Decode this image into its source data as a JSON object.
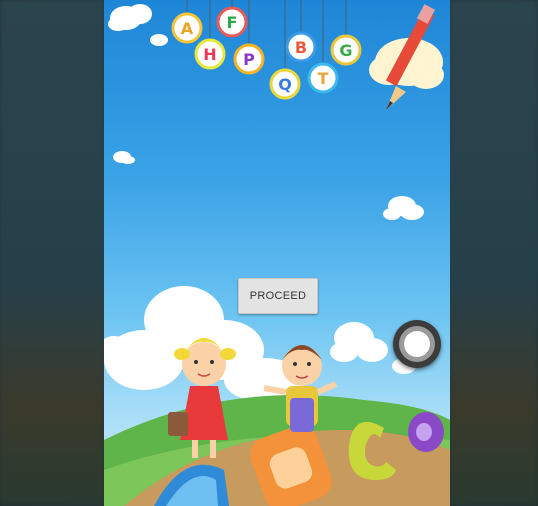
{
  "screen": {
    "background_colors": {
      "sky_top": "#1e86d6",
      "sky_bottom": "#c9ebfb",
      "letterbox": "#2a3f48"
    }
  },
  "hanging_letters": [
    {
      "letter": "A",
      "color": "#e8a422",
      "ring": "#f7c43a"
    },
    {
      "letter": "F",
      "color": "#2ca84a",
      "ring": "#e85a5a"
    },
    {
      "letter": "H",
      "color": "#e83a5a",
      "ring": "#e8e83a"
    },
    {
      "letter": "P",
      "color": "#8a3ac8",
      "ring": "#f5b323"
    },
    {
      "letter": "B",
      "color": "#e85a3a",
      "ring": "#3a9ae8"
    },
    {
      "letter": "G",
      "color": "#3aa84a",
      "ring": "#e8c83a"
    },
    {
      "letter": "Q",
      "color": "#3a7ae8",
      "ring": "#e8d83a"
    },
    {
      "letter": "T",
      "color": "#e8a43a",
      "ring": "#3ab8e8"
    }
  ],
  "proceed_button": {
    "label": "PROCEED"
  },
  "ground_letters": [
    "a",
    "b",
    "c",
    "d"
  ],
  "fab": {
    "icon": "radio-button-icon"
  }
}
